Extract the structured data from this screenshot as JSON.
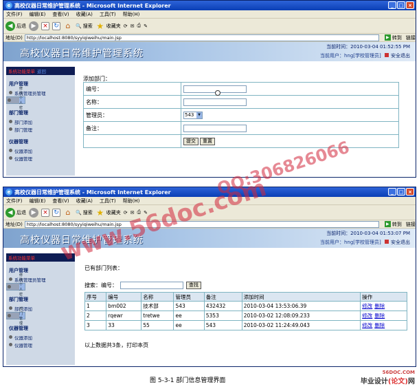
{
  "browser": {
    "title": "高校仪器日常维护管理系统 - Microsoft Internet Explorer",
    "menu": [
      "文件(F)",
      "编辑(E)",
      "查看(V)",
      "收藏(A)",
      "工具(T)",
      "帮助(H)"
    ],
    "toolbar": {
      "back": "后退",
      "search": "搜索",
      "favorites": "收藏夹"
    },
    "address_label": "地址(D)",
    "go": "转到",
    "links": "链接"
  },
  "app": {
    "system_name": "高校仪器日常维护管理系统",
    "current_user": "当前用户：hng[学校管理员]",
    "logout": "安全退出"
  },
  "sidebar": {
    "title": "系统功能菜单",
    "back": "返回",
    "groups": [
      {
        "name": "用户管理",
        "items": [
          "系统管理员管理",
          "修改个人密码"
        ]
      },
      {
        "name": "部门管理",
        "items": [
          "部门添加",
          "部门管理"
        ]
      },
      {
        "name": "仪器管理",
        "items": [
          "仪器添加",
          "仪器管理"
        ]
      }
    ]
  },
  "window1": {
    "address": "http://localhost:8080/syyiqiweihu/main.jsp",
    "time": "当前时间：2010-03-04 01:52:55 PM",
    "form": {
      "title": "添加部门：",
      "labels": [
        "编号：",
        "名称：",
        "管理员：",
        "备注："
      ],
      "manager_value": "543",
      "submit": "提交",
      "reset": "重置"
    }
  },
  "window2": {
    "address": "http://localhost:8080/syyiqiweihu/main.jsp",
    "time": "当前时间：2010-03-04 01:53:07 PM",
    "list_title": "已有部门列表：",
    "search_label": "搜索：编号：",
    "search_button": "查找",
    "columns": [
      "序号",
      "编号",
      "名称",
      "管理员",
      "备注",
      "添加时间",
      "操作"
    ],
    "rows": [
      [
        "1",
        "bm002",
        "技术部",
        "543",
        "432432",
        "2010-03-04 13:53:06.39"
      ],
      [
        "2",
        "rqewr",
        "tretwe",
        "ee",
        "5353",
        "2010-03-02 12:08:09.233"
      ],
      [
        "3",
        "33",
        "55",
        "ee",
        "543",
        "2010-03-02 11:24:49.043"
      ]
    ],
    "edit": "修改",
    "delete": "删除",
    "summary": "以上数据共3条，打印本页"
  },
  "caption": "图 5-3-1 部门信息管理界面",
  "watermarks": [
    "www.56doc.com",
    "QQ:306826066"
  ],
  "logo": {
    "site": "56DOC.COM",
    "name_prefix": "毕业设计",
    "name_mid": "(论文)",
    "name_suffix": "网"
  }
}
